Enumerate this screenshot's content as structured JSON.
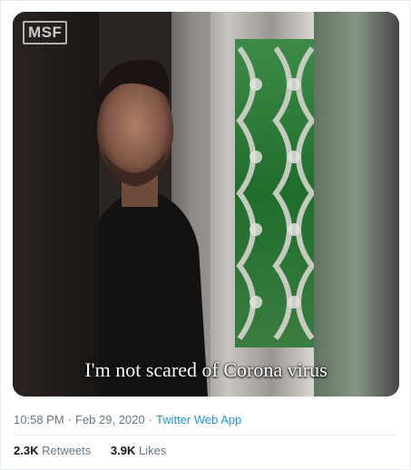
{
  "video": {
    "watermark": "MSF",
    "caption": "I'm not scared of Corona virus"
  },
  "tweet_meta": {
    "time": "10:58 PM",
    "separator_1": "·",
    "date": "Feb 29, 2020",
    "separator_2": "·",
    "source": "Twitter Web App"
  },
  "stats": {
    "retweets_count": "2.3K",
    "retweets_label": "Retweets",
    "likes_count": "3.9K",
    "likes_label": "Likes"
  },
  "colors": {
    "meta_text": "#657786",
    "link": "#1b95e0",
    "count_text": "#14171a",
    "divider": "#e6ecf0"
  }
}
